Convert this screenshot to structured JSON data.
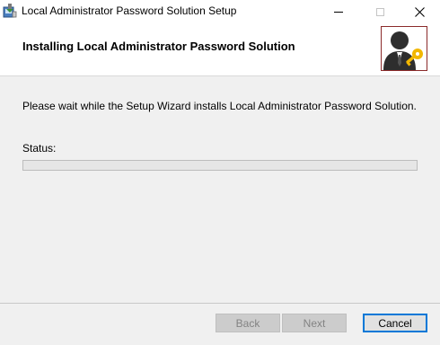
{
  "window": {
    "title": "Local Administrator Password Solution Setup",
    "icon": "installer-icon",
    "controls": [
      "minimize-icon",
      "maximize-icon",
      "close-icon"
    ]
  },
  "banner": {
    "title": "Installing Local Administrator Password Solution",
    "logo_icon": "admin-with-key-icon"
  },
  "main": {
    "message": "Please wait while the Setup Wizard installs Local Administrator Password Solution.",
    "status_label": "Status:",
    "progress": 0
  },
  "footer": {
    "back_label": "Back",
    "next_label": "Next",
    "cancel_label": "Cancel"
  },
  "colors": {
    "accent": "#0078d7",
    "logo_border": "#8b2a2a",
    "key": "#f2b700"
  }
}
